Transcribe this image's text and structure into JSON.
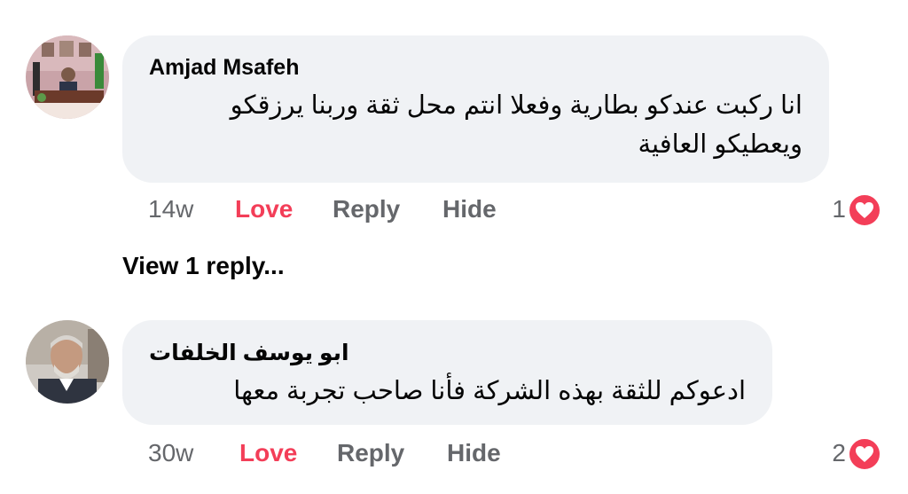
{
  "comments": [
    {
      "author": "Amjad Msafeh",
      "text_lines": [
        "انا ركبت عندكو بطارية وفعلا انتم محل ثقة وربنا يرزقكو",
        "ويعطيكو العافية"
      ],
      "time": "14w",
      "actions": {
        "love": "Love",
        "reply": "Reply",
        "hide": "Hide"
      },
      "reaction_count": "1",
      "reaction_icon": "love-heart-icon"
    },
    {
      "author": "ابو يوسف الخلفات",
      "text_lines": [
        "ادعوكم للثقة بهذه الشركة فأنا صاحب تجربة معها"
      ],
      "time": "30w",
      "actions": {
        "love": "Love",
        "reply": "Reply",
        "hide": "Hide"
      },
      "reaction_count": "2",
      "reaction_icon": "love-heart-icon"
    }
  ],
  "view_replies": "View 1 reply...",
  "colors": {
    "bubble": "#f0f2f5",
    "love_active": "#f33e58",
    "secondary_text": "#65676b",
    "primary_text": "#050505"
  }
}
